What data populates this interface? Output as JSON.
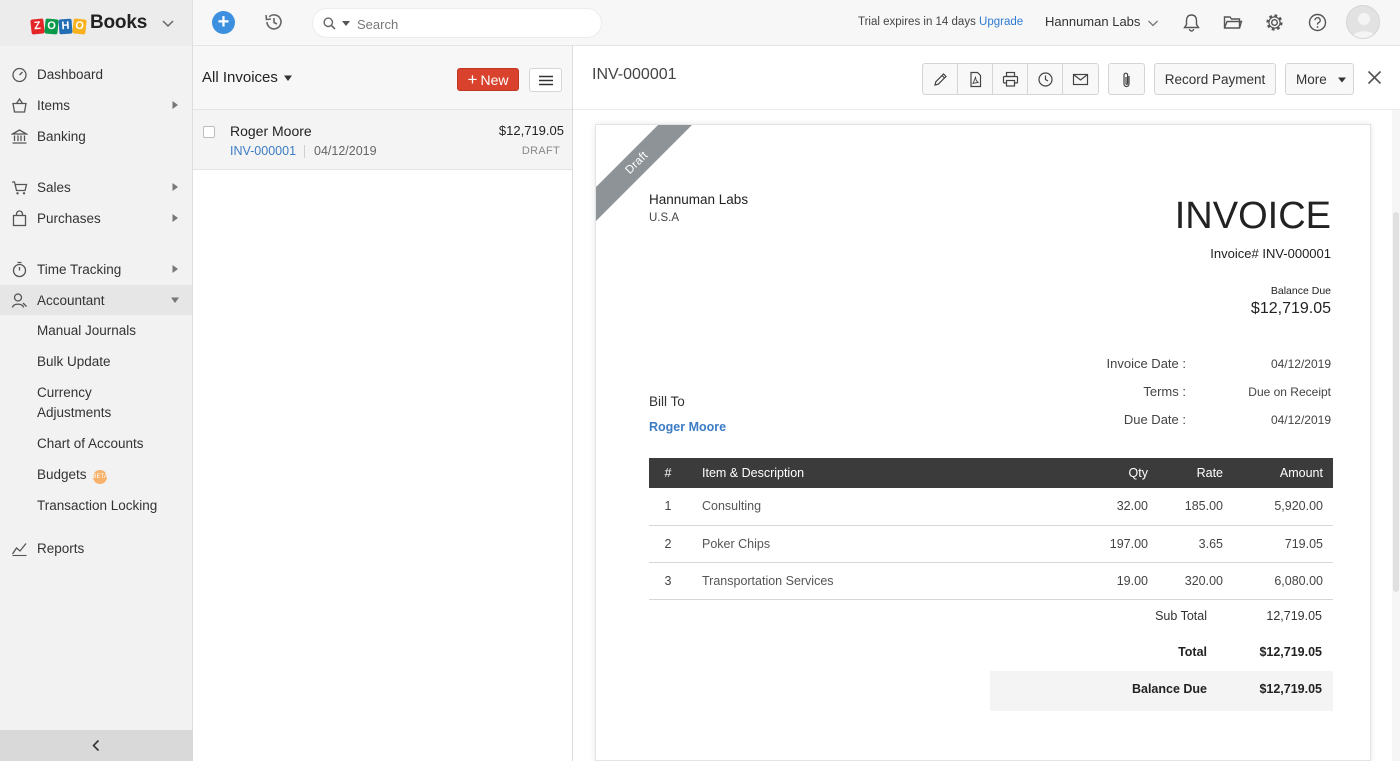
{
  "topbar": {
    "logo_letters": [
      "Z",
      "O",
      "H",
      "O"
    ],
    "app_name": "Books",
    "search_placeholder": "Search",
    "trial_text": "Trial expires in 14 days",
    "upgrade_label": "Upgrade",
    "org_name": "Hannuman Labs"
  },
  "sidebar": {
    "items": [
      {
        "label": "Dashboard"
      },
      {
        "label": "Items"
      },
      {
        "label": "Banking"
      },
      {
        "label": "Sales"
      },
      {
        "label": "Purchases"
      },
      {
        "label": "Time Tracking"
      },
      {
        "label": "Accountant"
      },
      {
        "label": "Reports"
      }
    ],
    "accountant_subitems": [
      {
        "label": "Manual Journals"
      },
      {
        "label": "Bulk Update"
      },
      {
        "label": "Currency"
      },
      {
        "label": "Adjustments"
      },
      {
        "label": "Chart of Accounts"
      },
      {
        "label": "Budgets"
      },
      {
        "label": "Transaction Locking"
      }
    ],
    "budgets_badge": "BETA"
  },
  "list": {
    "title": "All Invoices",
    "new_label": "New",
    "rows": [
      {
        "customer": "Roger Moore",
        "amount": "$12,719.05",
        "number": "INV-000001",
        "date": "04/12/2019",
        "status": "DRAFT"
      }
    ]
  },
  "detail": {
    "title": "INV-000001",
    "record_payment_label": "Record Payment",
    "more_label": "More"
  },
  "invoice": {
    "ribbon": "Draft",
    "org_name": "Hannuman Labs",
    "org_country": "U.S.A",
    "heading": "INVOICE",
    "number_line": "Invoice# INV-000001",
    "balance_due_label": "Balance Due",
    "balance_due": "$12,719.05",
    "meta": [
      {
        "label": "Invoice Date :",
        "value": "04/12/2019"
      },
      {
        "label": "Terms :",
        "value": "Due on Receipt"
      },
      {
        "label": "Due Date :",
        "value": "04/12/2019"
      }
    ],
    "bill_to_label": "Bill To",
    "bill_to_name": "Roger Moore",
    "columns": {
      "idx": "#",
      "desc": "Item & Description",
      "qty": "Qty",
      "rate": "Rate",
      "amount": "Amount"
    },
    "lines": [
      {
        "idx": "1",
        "desc": "Consulting",
        "qty": "32.00",
        "rate": "185.00",
        "amount": "5,920.00"
      },
      {
        "idx": "2",
        "desc": "Poker Chips",
        "qty": "197.00",
        "rate": "3.65",
        "amount": "719.05"
      },
      {
        "idx": "3",
        "desc": "Transportation Services",
        "qty": "19.00",
        "rate": "320.00",
        "amount": "6,080.00"
      }
    ],
    "totals": {
      "sub_total_label": "Sub Total",
      "sub_total": "12,719.05",
      "total_label": "Total",
      "total": "$12,719.05",
      "balance_label": "Balance Due",
      "balance": "$12,719.05"
    }
  },
  "colors": {
    "accent_blue": "#3d8fe0",
    "link_blue": "#3c7cc4",
    "new_button_red": "#d9432e",
    "table_header": "#3b3b3b",
    "ribbon_gray": "#8d9396"
  },
  "icons": {
    "brand_chevron": "chevron-down-icon",
    "quick_create": "plus-circle-icon",
    "recent": "history-icon",
    "search": "search-icon",
    "notifications": "bell-icon",
    "files": "folder-icon",
    "settings": "gear-icon",
    "help": "help-icon",
    "edit": "pencil-icon",
    "pdf": "pdf-icon",
    "print": "printer-icon",
    "reminder": "clock-icon",
    "email": "envelope-icon",
    "attach": "paperclip-icon",
    "close": "close-icon",
    "collapse": "chevron-left-icon"
  }
}
